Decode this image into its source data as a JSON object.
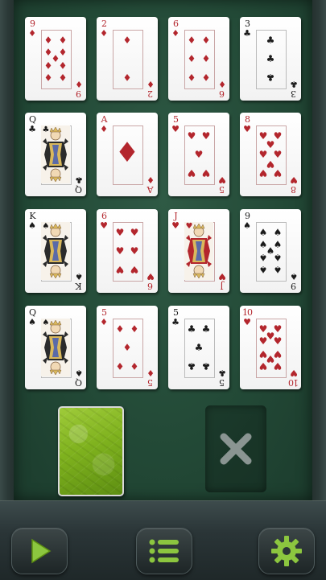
{
  "accent_color": "#8cc63f",
  "cards": [
    {
      "rank": "9",
      "suit": "♦",
      "color": "red",
      "kind": "pips",
      "count": 9
    },
    {
      "rank": "2",
      "suit": "♦",
      "color": "red",
      "kind": "pips",
      "count": 2
    },
    {
      "rank": "6",
      "suit": "♦",
      "color": "red",
      "kind": "pips",
      "count": 6
    },
    {
      "rank": "3",
      "suit": "♣",
      "color": "black",
      "kind": "pips",
      "count": 3
    },
    {
      "rank": "Q",
      "suit": "♣",
      "color": "black",
      "kind": "face"
    },
    {
      "rank": "A",
      "suit": "♦",
      "color": "red",
      "kind": "ace"
    },
    {
      "rank": "5",
      "suit": "♥",
      "color": "red",
      "kind": "pips",
      "count": 5
    },
    {
      "rank": "8",
      "suit": "♥",
      "color": "red",
      "kind": "pips",
      "count": 8
    },
    {
      "rank": "K",
      "suit": "♠",
      "color": "black",
      "kind": "face"
    },
    {
      "rank": "6",
      "suit": "♥",
      "color": "red",
      "kind": "pips",
      "count": 6
    },
    {
      "rank": "J",
      "suit": "♥",
      "color": "red",
      "kind": "face"
    },
    {
      "rank": "9",
      "suit": "♠",
      "color": "black",
      "kind": "pips",
      "count": 9
    },
    {
      "rank": "Q",
      "suit": "♠",
      "color": "black",
      "kind": "face"
    },
    {
      "rank": "5",
      "suit": "♦",
      "color": "red",
      "kind": "pips",
      "count": 5
    },
    {
      "rank": "5",
      "suit": "♣",
      "color": "black",
      "kind": "pips",
      "count": 5
    },
    {
      "rank": "10",
      "suit": "♥",
      "color": "red",
      "kind": "pips",
      "count": 10
    }
  ],
  "deck": {
    "icon": "card-back"
  },
  "discard": {
    "icon": "close-icon"
  },
  "toolbar": {
    "play_icon": "play-icon",
    "menu_icon": "menu-list-icon",
    "settings_icon": "gear-icon"
  }
}
